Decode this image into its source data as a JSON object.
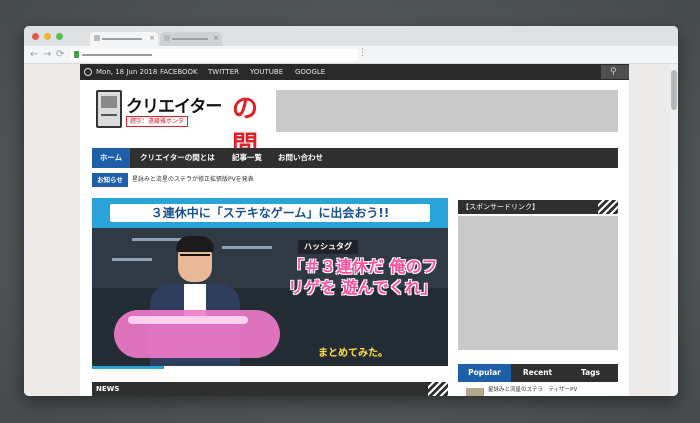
{
  "browser": {
    "tabs": [
      {
        "close": "×"
      },
      {
        "close": "×"
      }
    ],
    "nav": {
      "back": "←",
      "forward": "→",
      "reload": "⟳"
    },
    "menu_icon": "⋮"
  },
  "site": {
    "topbar": {
      "date": "Mon, 18 Jun 2018",
      "links": [
        "FACEBOOK",
        "TWITTER",
        "YOUTUBE",
        "GOOGLE"
      ],
      "search_icon": "⚲"
    },
    "logo": {
      "title": "クリエイター",
      "title_accent": "の間",
      "subtitle": "題字：遠藤雅ボンタ"
    },
    "nav": [
      "ホーム",
      "クリエイターの間とは",
      "記事一覧",
      "お問い合わせ"
    ],
    "notice": {
      "label": "お知らせ",
      "text": "星詠みと流星のステラが修正拡張版PVを発表"
    },
    "hero": {
      "banner": "３連休中に「ステキなゲーム」に出会おう!!",
      "hashtag_label": "ハッシュタグ",
      "big_text": "「＃３連休だ 俺のフリゲを 遊んでくれ」",
      "sub_text": "まとめてみた。"
    },
    "sidebar": {
      "sponsored_title": "【スポンサードリンク】",
      "tabs": [
        "Popular",
        "Recent",
        "Tags"
      ],
      "first_item": "星詠みと流星のステラ　ティザーPV"
    },
    "news_label": "NEWS"
  }
}
